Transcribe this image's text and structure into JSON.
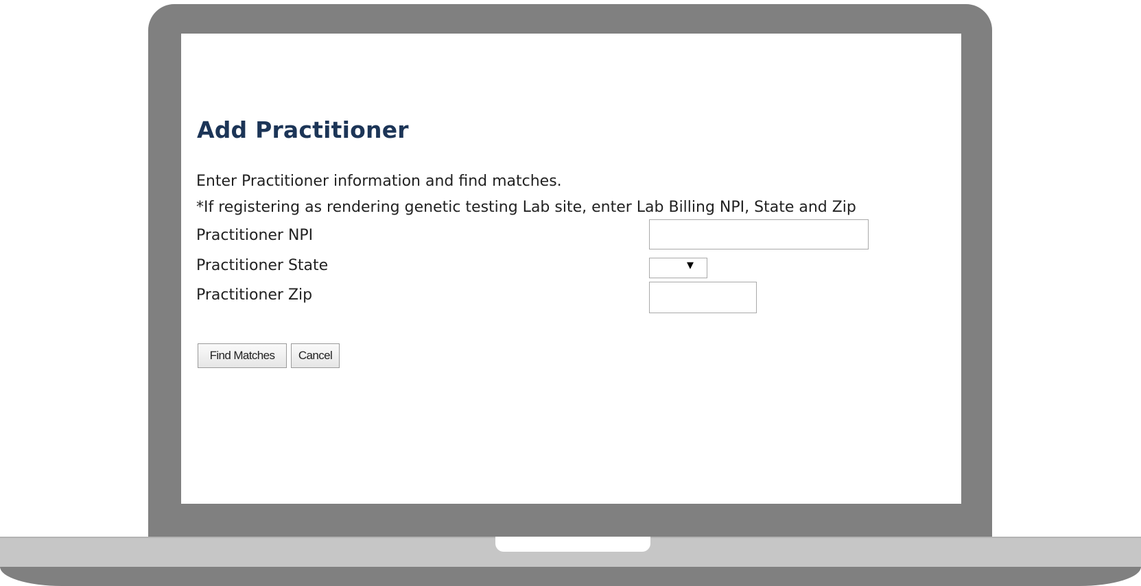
{
  "page": {
    "title": "Add Practitioner",
    "instruction": "Enter Practitioner information and find matches.",
    "note": "*If registering as rendering genetic testing Lab site, enter Lab Billing NPI, State and Zip"
  },
  "form": {
    "npi": {
      "label": "Practitioner NPI",
      "value": ""
    },
    "state": {
      "label": "Practitioner State",
      "selected": ""
    },
    "zip": {
      "label": "Practitioner Zip",
      "value": ""
    }
  },
  "buttons": {
    "find_matches": "Find Matches",
    "cancel": "Cancel"
  },
  "icons": {
    "dropdown": "chevron-down-icon"
  }
}
